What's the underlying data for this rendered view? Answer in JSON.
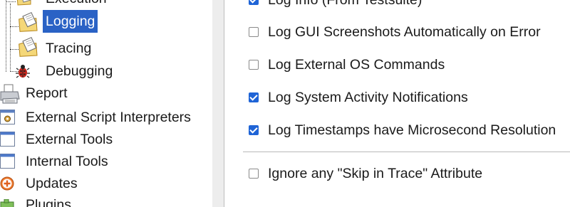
{
  "tree": {
    "items": [
      {
        "label": "Execution",
        "icon": "folder-doc-icon"
      },
      {
        "label": "Logging",
        "icon": "folder-doc-icon",
        "selected": true
      },
      {
        "label": "Tracing",
        "icon": "folder-doc-icon"
      },
      {
        "label": "Debugging",
        "icon": "bug-icon"
      },
      {
        "label": "Report",
        "icon": "printer-icon"
      },
      {
        "label": "External Script Interpreters",
        "icon": "gear-window-icon"
      },
      {
        "label": "External Tools",
        "icon": "window-icon"
      },
      {
        "label": "Internal Tools",
        "icon": "window-icon"
      },
      {
        "label": "Updates",
        "icon": "update-plus-icon"
      },
      {
        "label": "Plugins",
        "icon": "plugin-icon"
      }
    ]
  },
  "options": {
    "items": [
      {
        "label": "Log Info (From Testsuite)",
        "checked": true
      },
      {
        "label": "Log GUI Screenshots Automatically on Error",
        "checked": false
      },
      {
        "label": "Log External OS Commands",
        "checked": false
      },
      {
        "label": "Log System Activity Notifications",
        "checked": true
      },
      {
        "label": "Log Timestamps have Microsecond Resolution",
        "checked": true
      },
      {
        "label": "Ignore any \"Skip in Trace\" Attribute",
        "checked": false
      }
    ]
  },
  "colors": {
    "selection": "#2a62c5",
    "checkbox_checked": "#1f64d6",
    "splitter": "#ededed"
  }
}
